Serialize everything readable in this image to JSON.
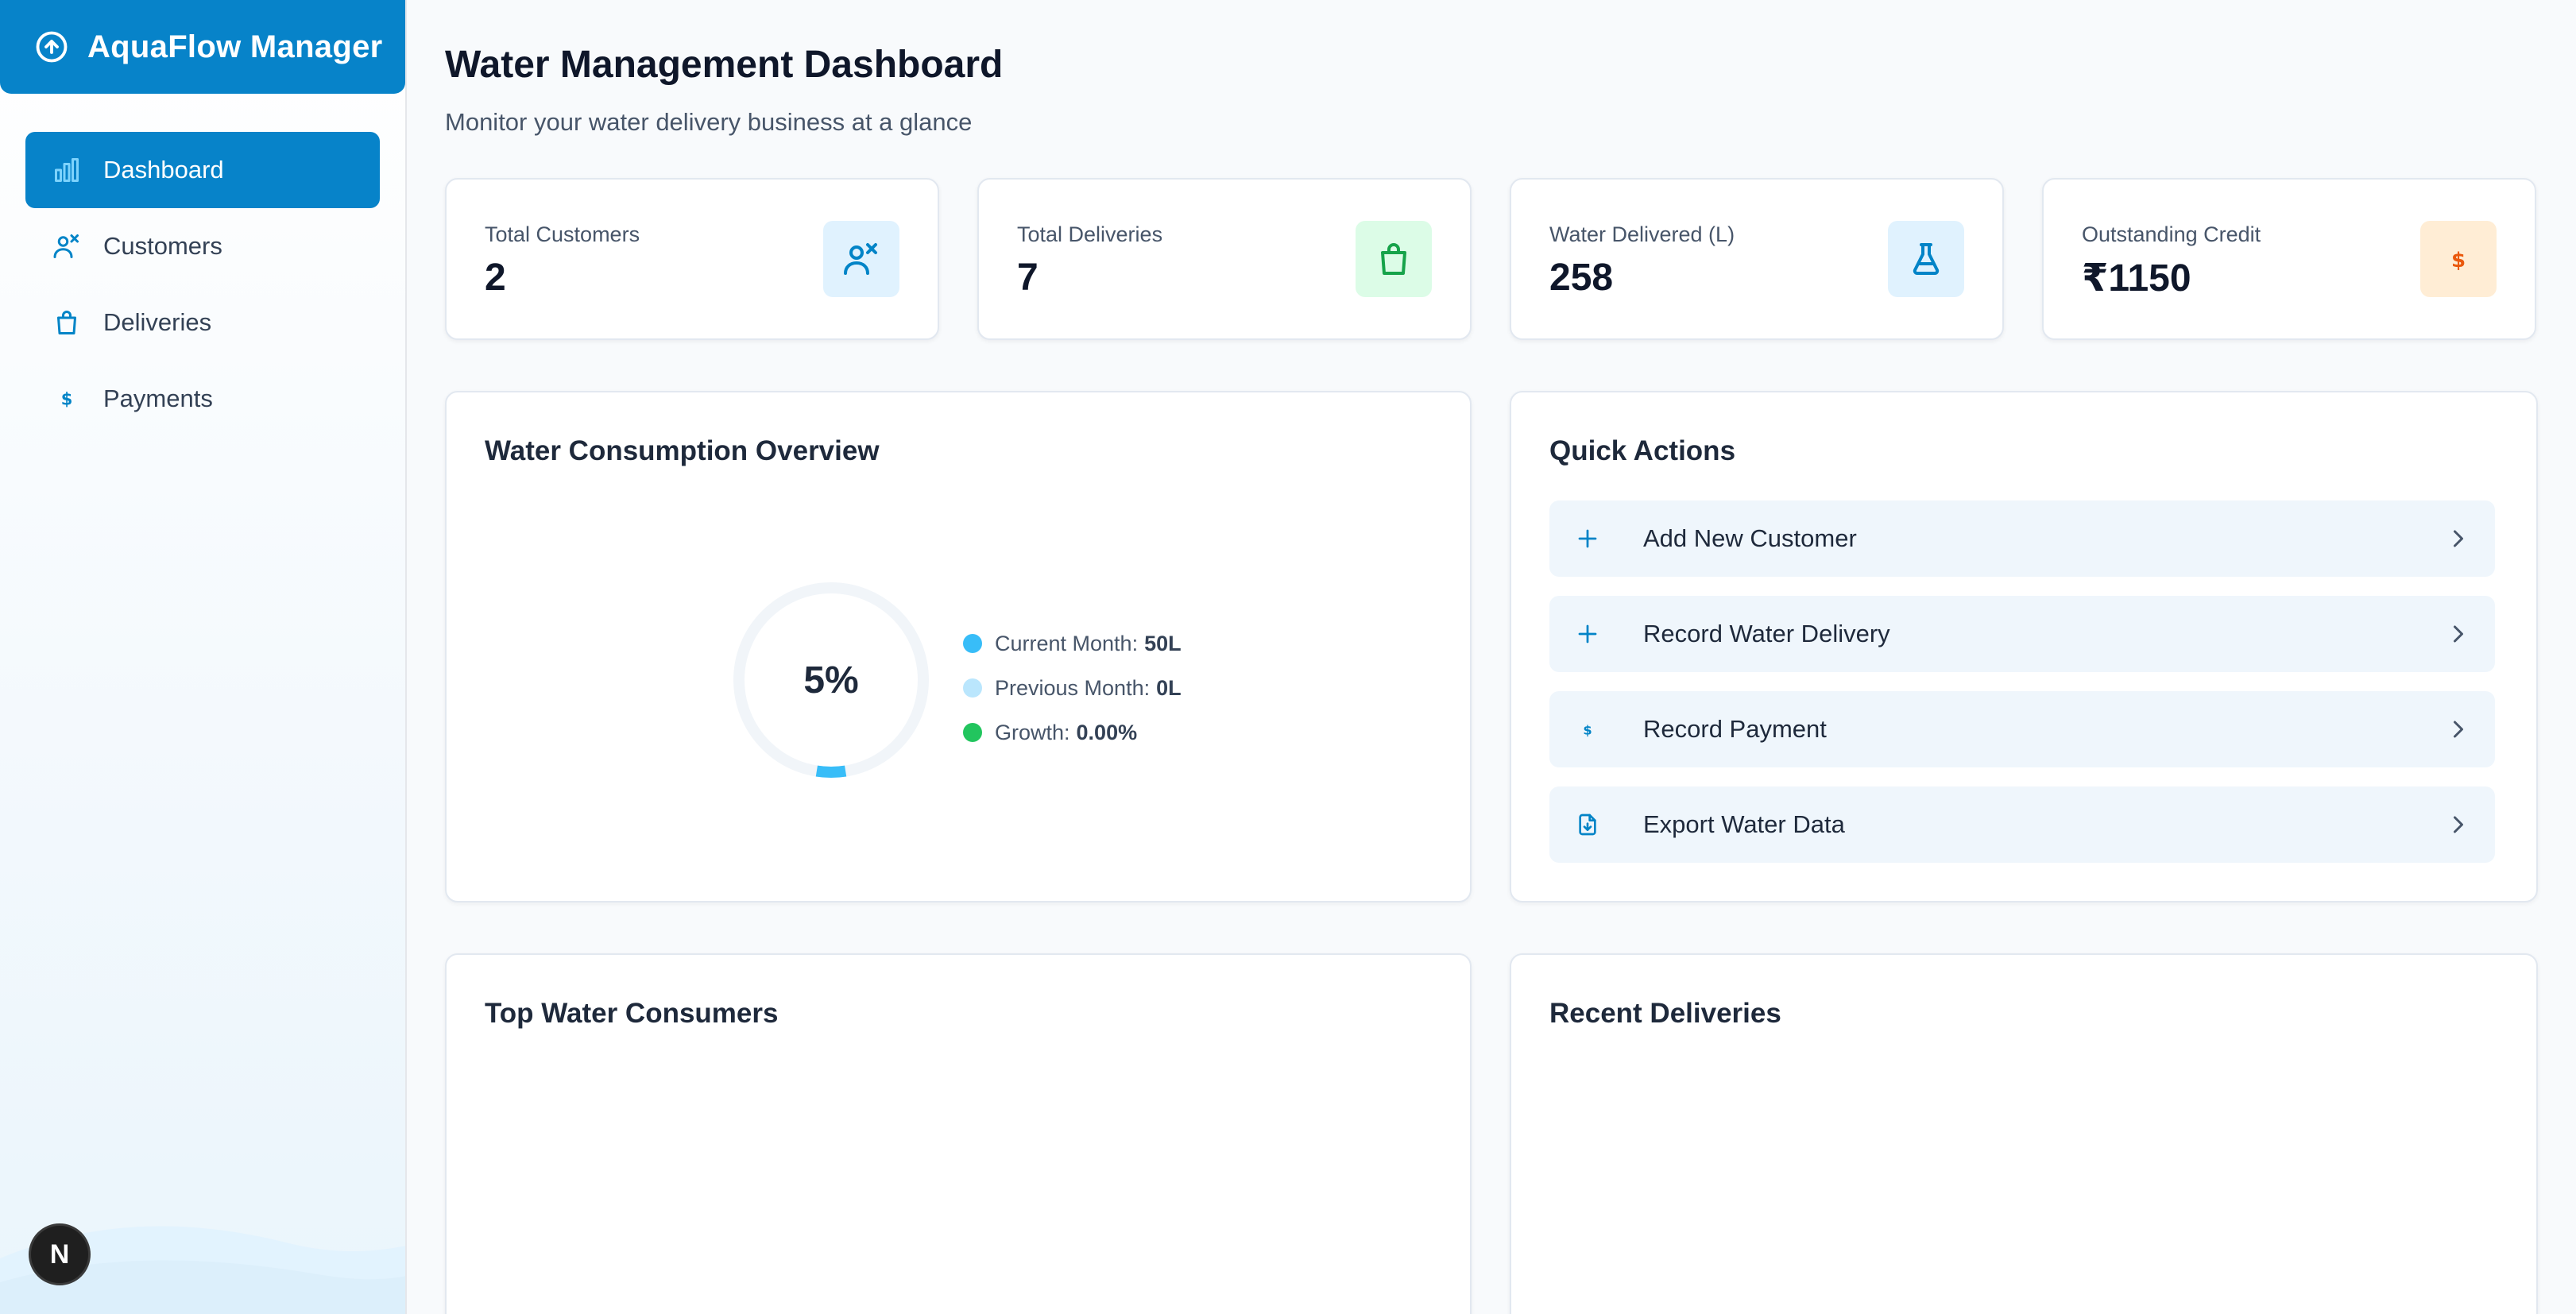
{
  "app": {
    "name": "AquaFlow Manager"
  },
  "sidebar": {
    "items": [
      {
        "label": "Dashboard",
        "icon": "bar-chart-icon",
        "active": true
      },
      {
        "label": "Customers",
        "icon": "users-icon",
        "active": false
      },
      {
        "label": "Deliveries",
        "icon": "shopping-bag-icon",
        "active": false
      },
      {
        "label": "Payments",
        "icon": "dollar-icon",
        "active": false
      }
    ],
    "badge": "N"
  },
  "header": {
    "title": "Water Management Dashboard",
    "subtitle": "Monitor your water delivery business at a glance"
  },
  "stats": [
    {
      "label": "Total Customers",
      "value": "2",
      "icon": "users-icon",
      "icon_bg": "#e0f2fe",
      "icon_color": "#0284c7"
    },
    {
      "label": "Total Deliveries",
      "value": "7",
      "icon": "shopping-bag-icon",
      "icon_bg": "#dcfce7",
      "icon_color": "#16a34a"
    },
    {
      "label": "Water Delivered (L)",
      "value": "258",
      "icon": "flask-icon",
      "icon_bg": "#e0f2fe",
      "icon_color": "#0284c7"
    },
    {
      "label": "Outstanding Credit",
      "value": "₹1150",
      "icon": "dollar-icon",
      "icon_bg": "#ffedd5",
      "icon_color": "#ea580c"
    }
  ],
  "consumption": {
    "title": "Water Consumption Overview",
    "percent_label": "5%",
    "percent": 5,
    "legend": [
      {
        "label": "Current Month:",
        "value": "50L",
        "color": "#38bdf8"
      },
      {
        "label": "Previous Month:",
        "value": "0L",
        "color": "#bae6fd"
      },
      {
        "label": "Growth:",
        "value": "0.00%",
        "color": "#22c55e"
      }
    ]
  },
  "quick_actions": {
    "title": "Quick Actions",
    "items": [
      {
        "label": "Add New Customer",
        "icon": "plus-icon"
      },
      {
        "label": "Record Water Delivery",
        "icon": "plus-icon"
      },
      {
        "label": "Record Payment",
        "icon": "dollar-icon"
      },
      {
        "label": "Export Water Data",
        "icon": "file-download-icon"
      }
    ]
  },
  "top_consumers": {
    "title": "Top Water Consumers"
  },
  "recent_deliveries": {
    "title": "Recent Deliveries"
  },
  "colors": {
    "primary": "#0783c9",
    "accent": "#0ea5e9"
  }
}
